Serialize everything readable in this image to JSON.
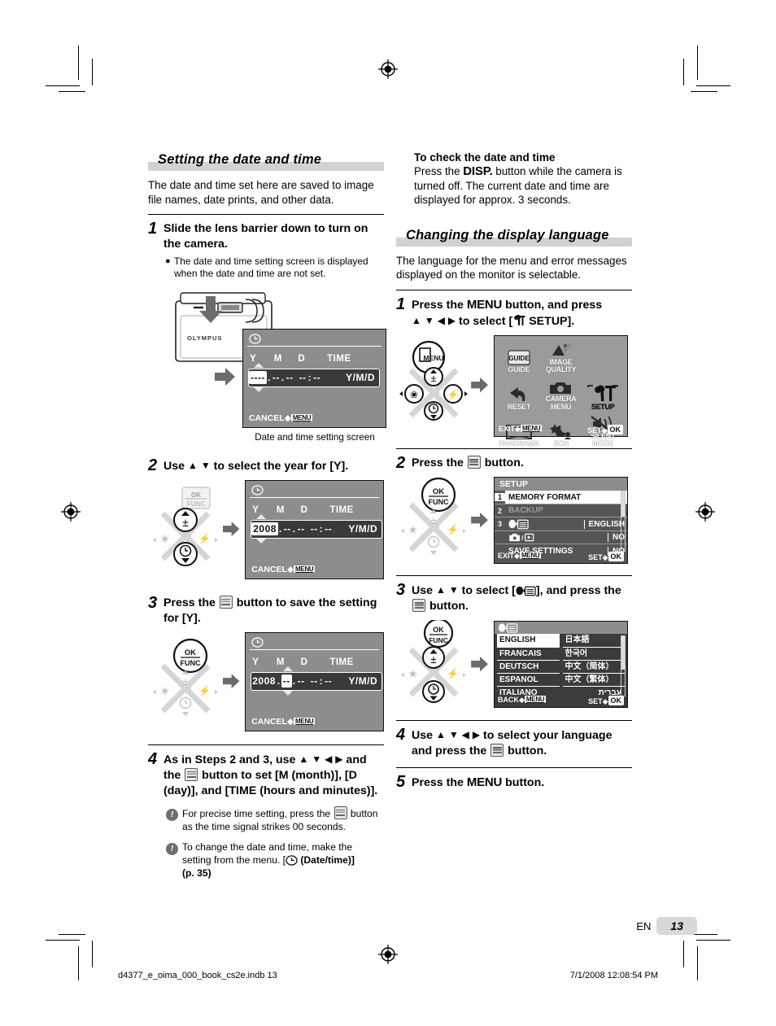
{
  "page": {
    "number": "13",
    "lang_code": "EN",
    "footer_file": "d4377_e_oima_000_book_cs2e.indb   13",
    "footer_date": "7/1/2008   12:08:54 PM"
  },
  "left": {
    "heading": "Setting the date and time",
    "intro": "The date and time set here are saved to image file names, date prints, and other data.",
    "step1": {
      "num": "1",
      "text": "Slide the lens barrier down to turn on the camera.",
      "bullet": "The date and time setting screen is displayed when the date and time are not set.",
      "caption": "Date and time setting screen",
      "camera_brand": "OLYMPUS"
    },
    "step2": {
      "num": "2",
      "text_a": "Use ",
      "text_b": " to select the year for [Y]."
    },
    "step3": {
      "num": "3",
      "text_a": "Press the ",
      "text_b": " button to save the setting for [Y]."
    },
    "step4": {
      "num": "4",
      "text_a": "As in Steps 2 and 3, use ",
      "text_b": " and the ",
      "text_c": " button to set [M (month)], [D (day)], and [TIME (hours and minutes)].",
      "note1_a": "For precise time setting, press the ",
      "note1_b": " button as the time signal strikes 00 seconds.",
      "note2_a": "To change the date and time, make the setting from the menu. [",
      "note2_b": " (Date/time)]",
      "note2_c": "(p. 35)"
    }
  },
  "right": {
    "check_head": "To check the date and time",
    "check_body_a": "Press the ",
    "check_disp": "DISP.",
    "check_body_b": " button while the camera is turned off. The current date and time are displayed for approx. 3 seconds.",
    "heading": "Changing the display language",
    "intro": "The language for the menu and error messages displayed on the monitor is selectable.",
    "step1": {
      "num": "1",
      "text_a": "Press the ",
      "menu_label": "MENU",
      "text_b": " button, and press ",
      "text_c": " to select [",
      "text_d": " SETUP]."
    },
    "step2": {
      "num": "2",
      "text_a": "Press the ",
      "text_b": " button."
    },
    "step3": {
      "num": "3",
      "text_a": "Use ",
      "text_b": " to select [",
      "text_c": "], and press the ",
      "text_d": " button."
    },
    "step4": {
      "num": "4",
      "text_a": "Use ",
      "text_b": " to select your language and press the ",
      "text_c": " button."
    },
    "step5": {
      "num": "5",
      "text_a": "Press the ",
      "menu_label": "MENU",
      "text_b": " button."
    }
  },
  "screens": {
    "datetime": {
      "headers": [
        "Y",
        "M",
        "D",
        "TIME"
      ],
      "format": "Y/M/D",
      "cancel": "CANCEL",
      "cancel_key": "MENU",
      "variants": {
        "blank": {
          "year": "----",
          "month": "--",
          "day": "--",
          "hour": "--",
          "min": "--",
          "highlight": "year"
        },
        "year": {
          "year": "2008",
          "month": "--",
          "day": "--",
          "hour": "--",
          "min": "--",
          "highlight": "year"
        },
        "month": {
          "year": "2008",
          "month": "--",
          "day": "--",
          "hour": "--",
          "min": "--",
          "highlight": "month"
        }
      }
    },
    "top_menu": {
      "items": [
        {
          "label": "GUIDE",
          "icon": "guide-icon"
        },
        {
          "label": "IMAGE\nQUALITY",
          "icon": "image-quality-icon"
        },
        {
          "label": "",
          "icon": "blank"
        },
        {
          "label": "RESET",
          "icon": "reset-icon"
        },
        {
          "label": "CAMERA\nMENU",
          "icon": "camera-menu-icon"
        },
        {
          "label": "SETUP",
          "icon": "setup-wrench-icon"
        },
        {
          "label": "PANORAMA",
          "icon": "panorama-icon"
        },
        {
          "label": "SCN",
          "icon": "scene-icon"
        },
        {
          "label": "SILENT\nMODE",
          "icon": "silent-mode-icon"
        }
      ],
      "exit_label": "EXIT",
      "exit_key": "MENU",
      "set_label": "SET",
      "set_key": "OK"
    },
    "setup": {
      "title": "SETUP",
      "rows": [
        {
          "index": "1",
          "label": "MEMORY FORMAT",
          "value": "",
          "state": "selected"
        },
        {
          "index": "2",
          "label": "BACKUP",
          "value": "",
          "state": "dim"
        },
        {
          "index": "3",
          "label": "",
          "value": "ENGLISH",
          "state": "icon-language"
        },
        {
          "index": "",
          "label": "",
          "value": "NO",
          "state": "icon-rec-play"
        },
        {
          "index": "",
          "label": "SAVE SETTINGS",
          "value": "NO",
          "state": "normal"
        }
      ],
      "exit_label": "EXIT",
      "exit_key": "MENU",
      "set_label": "SET",
      "set_key": "OK"
    },
    "language": {
      "col_left": [
        "ENGLISH",
        "FRANCAIS",
        "DEUTSCH",
        "ESPANOL",
        "ITALIANO"
      ],
      "col_right": [
        "日本語",
        "한국어",
        "中文（简体）",
        "中文（繁体）",
        "עברית"
      ],
      "selected": "ENGLISH",
      "back_label": "BACK",
      "back_key": "MENU",
      "set_label": "SET",
      "set_key": "OK"
    },
    "pad": {
      "ok_line1": "OK",
      "ok_line2": "FUNC",
      "menu_label": "MENU"
    }
  },
  "colors": {
    "heading_band": "#d2d2d2",
    "lcd_gray": "#8d8d8d",
    "lcd_dark": "#3b3b3b",
    "page_badge": "#d8d8d8"
  }
}
